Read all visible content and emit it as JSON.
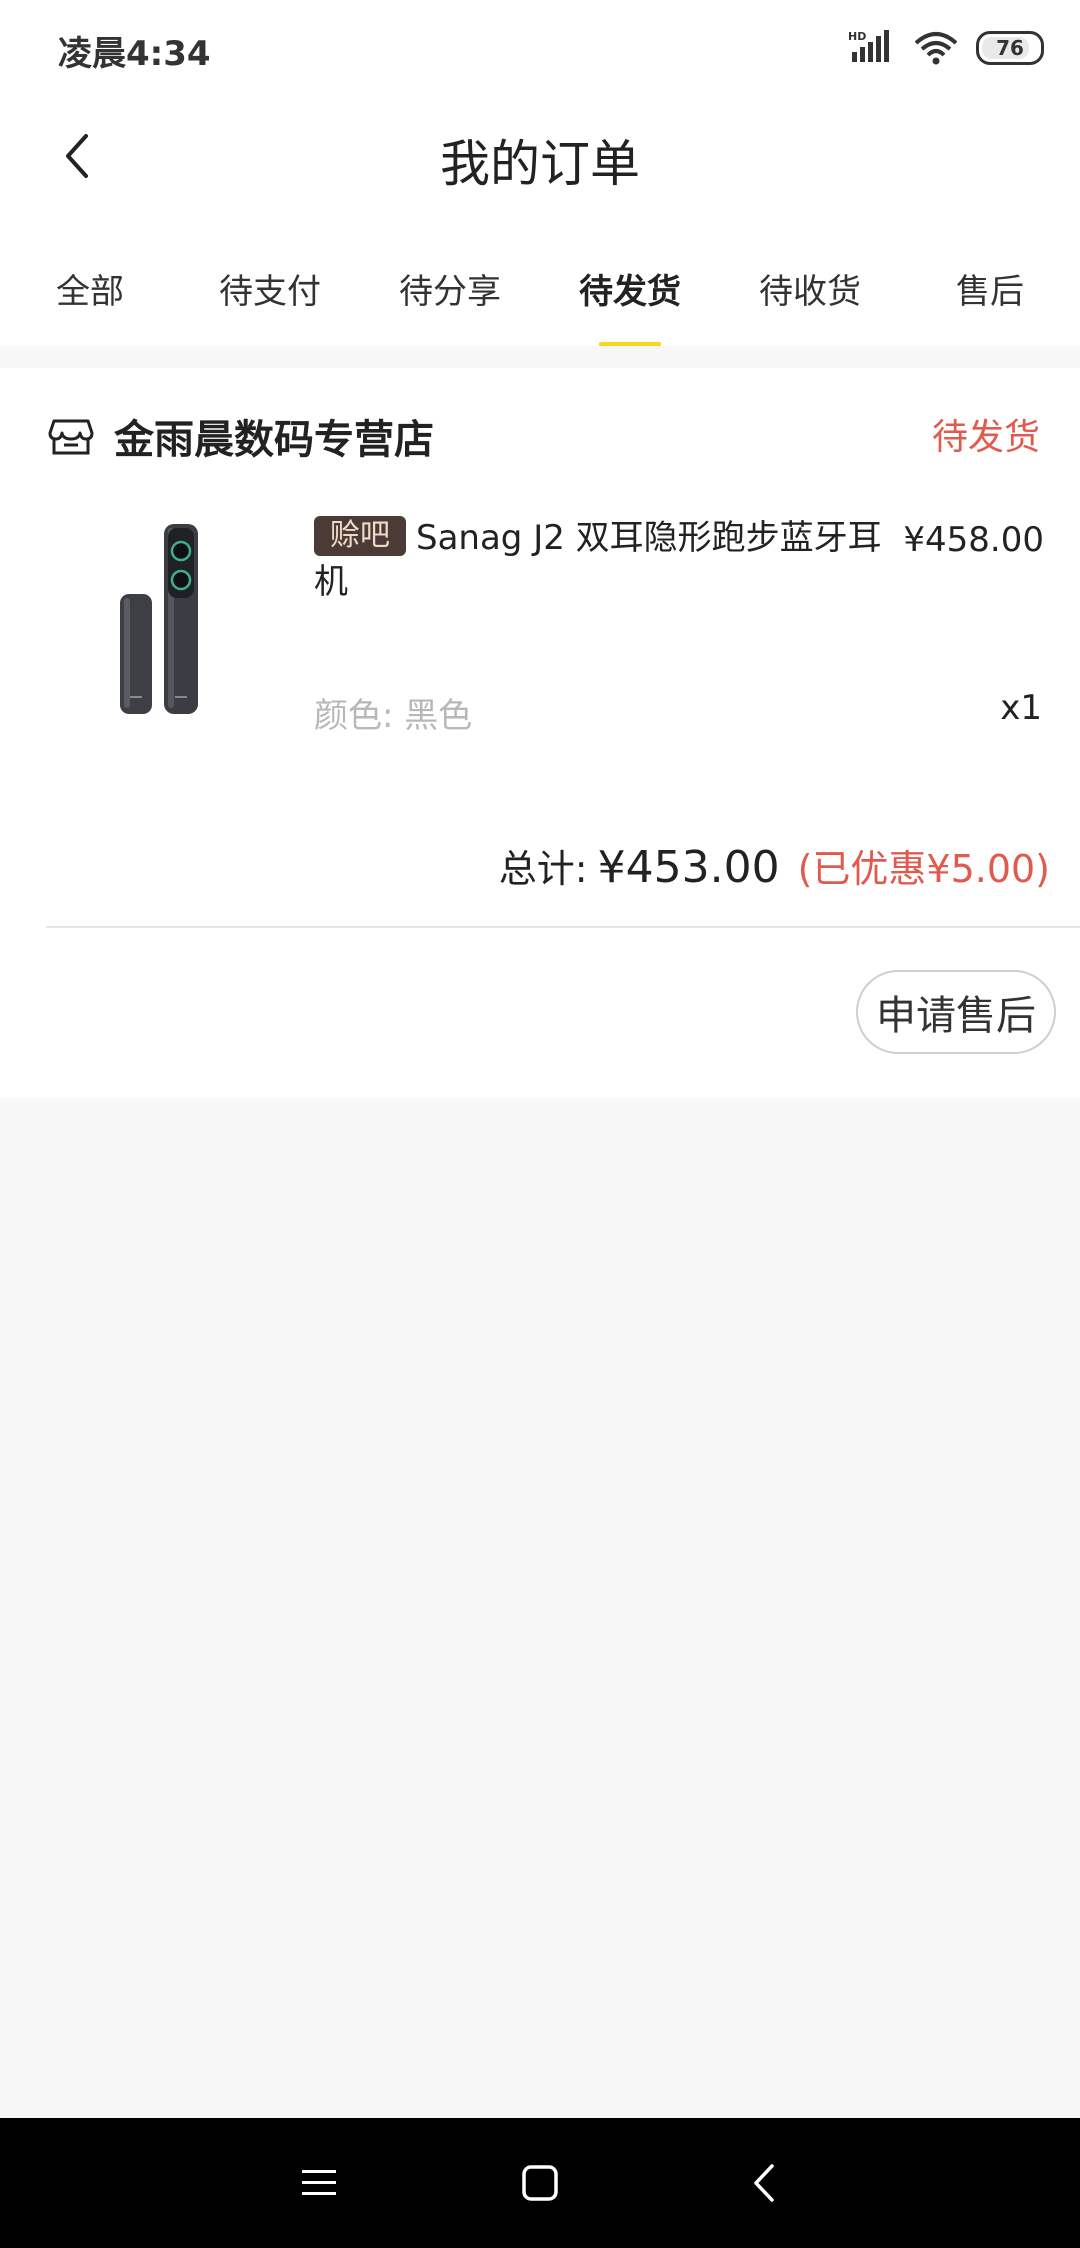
{
  "status_bar": {
    "time": "凌晨4:34",
    "network_label": "HD",
    "battery_level": "76"
  },
  "header": {
    "title": "我的订单"
  },
  "tabs": [
    {
      "label": "全部"
    },
    {
      "label": "待支付"
    },
    {
      "label": "待分享"
    },
    {
      "label": "待发货",
      "active": true
    },
    {
      "label": "待收货"
    },
    {
      "label": "售后"
    }
  ],
  "order": {
    "store_name": "金雨晨数码专营店",
    "status": "待发货",
    "product": {
      "tag": "赊吧",
      "title": "Sanag J2 双耳隐形跑步蓝牙耳机",
      "unit_price": "¥458.00",
      "attribute": "颜色: 黑色",
      "quantity": "x1"
    },
    "total_label": "总计:",
    "total_value": "¥453.00",
    "discount_text": "(已优惠¥5.00)",
    "action_button": "申请售后"
  },
  "colors": {
    "accent_yellow": "#f7d81a",
    "status_red": "#e25a4d"
  }
}
